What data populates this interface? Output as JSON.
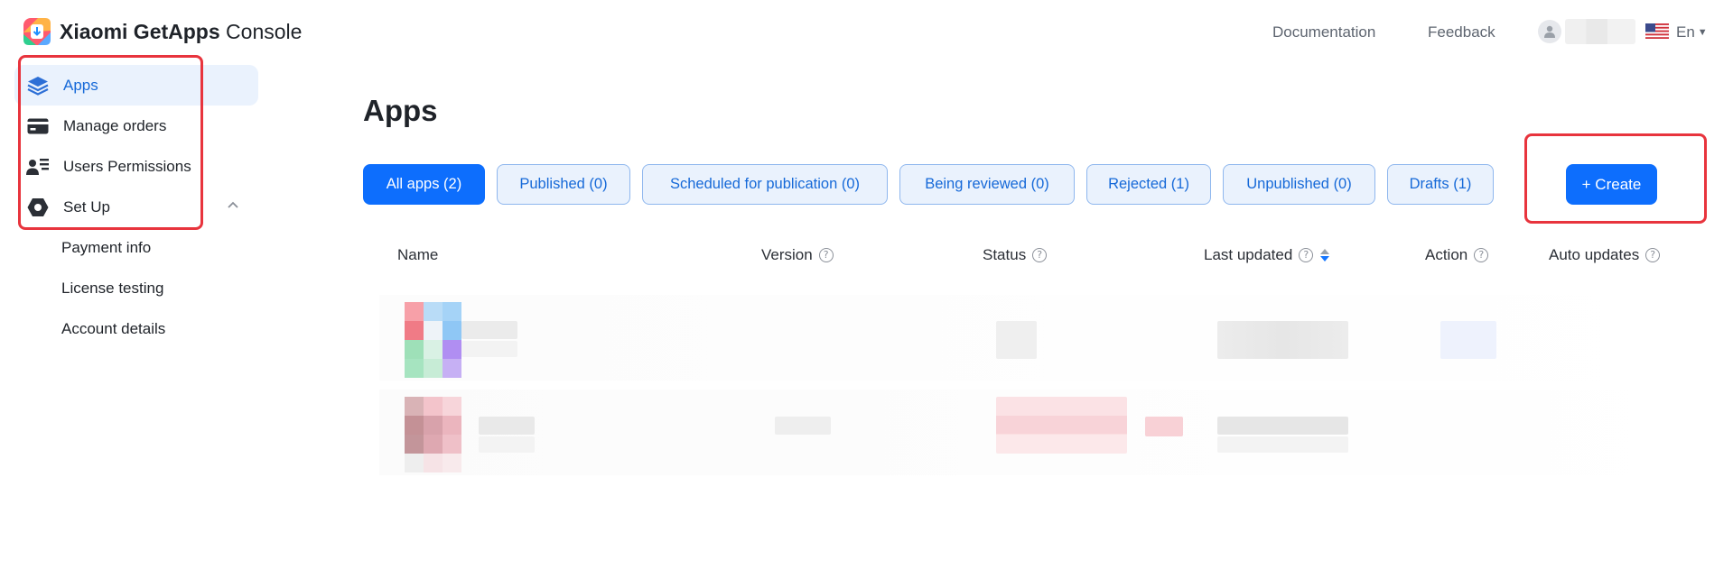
{
  "header": {
    "brand_bold": "Xiaomi GetApps",
    "brand_rest": " Console",
    "links": {
      "documentation": "Documentation",
      "feedback": "Feedback"
    },
    "language": "En"
  },
  "sidebar": {
    "items": [
      {
        "label": "Apps",
        "icon": "layers-icon",
        "active": true
      },
      {
        "label": "Manage orders",
        "icon": "card-icon"
      },
      {
        "label": "Users Permissions",
        "icon": "user-list-icon"
      },
      {
        "label": "Set Up",
        "icon": "hexagon-gear-icon",
        "expanded": true
      }
    ],
    "sub_items": [
      "Payment info",
      "License testing",
      "Account details"
    ]
  },
  "main": {
    "title": "Apps",
    "tabs": [
      {
        "label": "All apps (2)",
        "active": true
      },
      {
        "label": "Published (0)"
      },
      {
        "label": "Scheduled for publication (0)"
      },
      {
        "label": "Being reviewed (0)"
      },
      {
        "label": "Rejected (1)"
      },
      {
        "label": "Unpublished (0)"
      },
      {
        "label": "Drafts (1)"
      }
    ],
    "create_label": "+ Create",
    "table": {
      "columns": [
        "Name",
        "Version",
        "Status",
        "Last updated",
        "Action",
        "Auto updates"
      ],
      "help_glyph": "?"
    }
  },
  "colors": {
    "accent": "#0d6efd",
    "active_bg": "#eaf2fd",
    "highlight_box": "#e8343d"
  }
}
